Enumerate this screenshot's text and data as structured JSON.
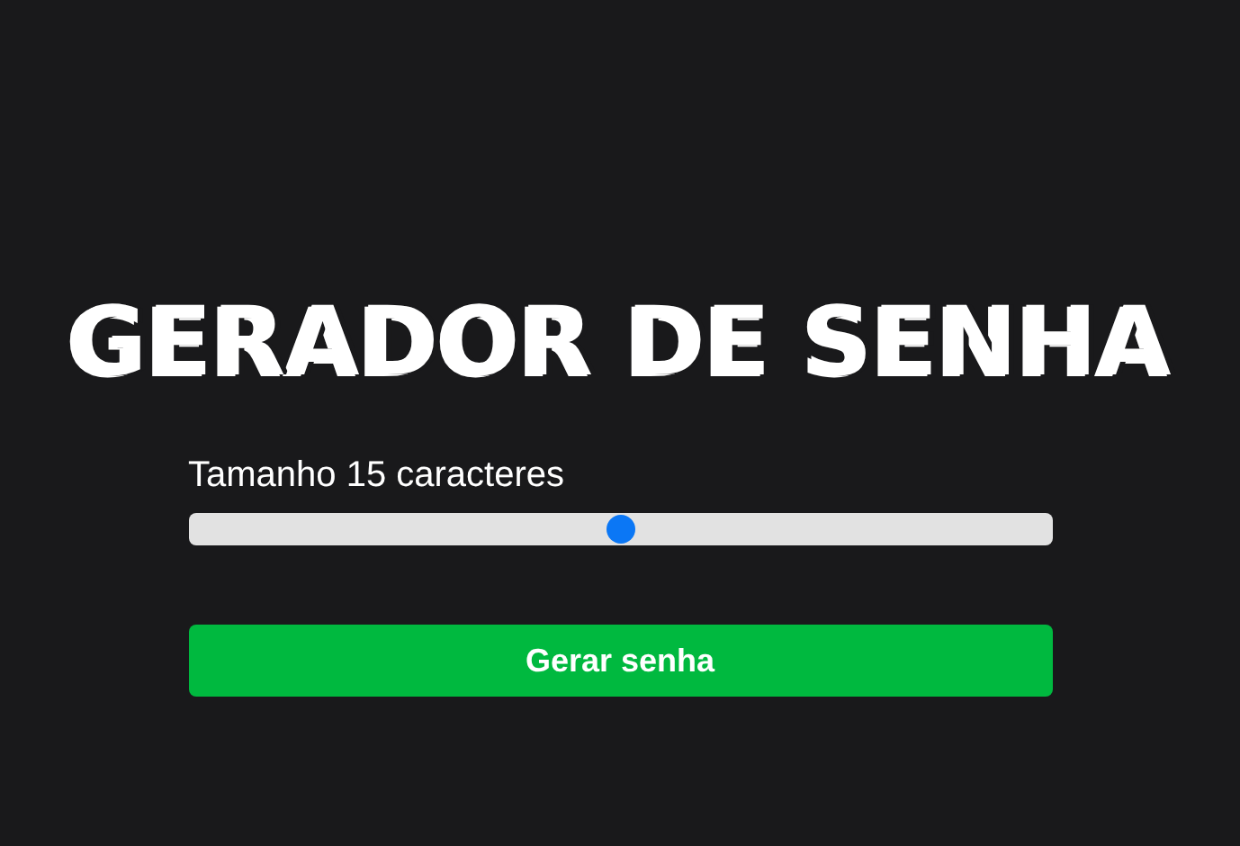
{
  "title": "GERADOR DE SENHA",
  "length": {
    "label": "Tamanho 15 caracteres",
    "level": 0.5
  },
  "button": {
    "label": "Gerar senha"
  }
}
